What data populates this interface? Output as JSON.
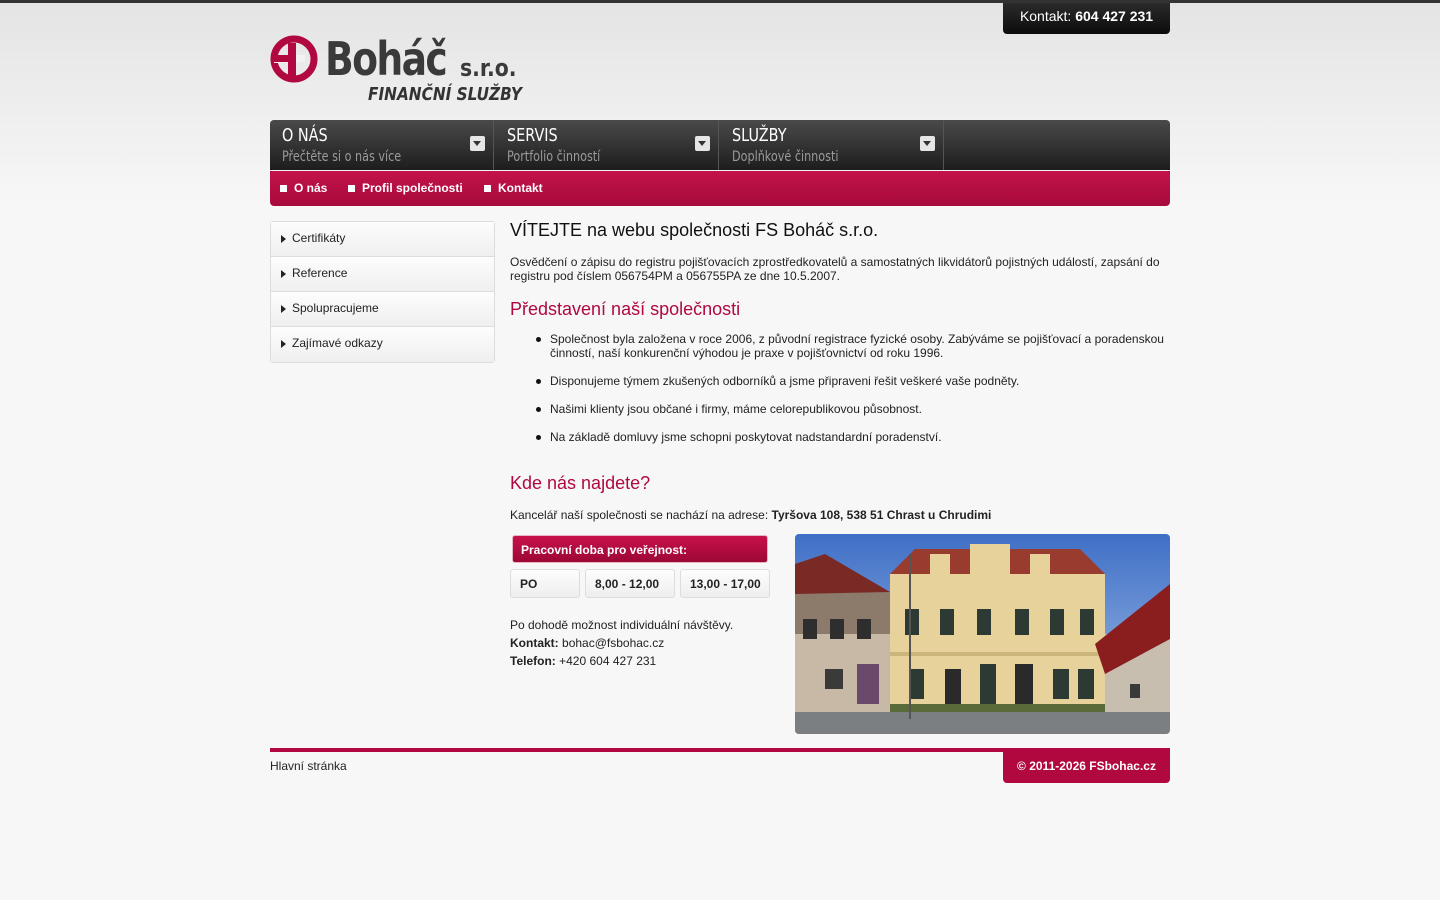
{
  "header": {
    "contact_label": "Kontakt:",
    "contact_phone": "604 427 231"
  },
  "logo": {
    "name": "Boháč",
    "suffix": "s.r.o.",
    "subtitle": "FINANČNÍ SLUŽBY",
    "icon": "fs-logo-mark-icon",
    "brand_color": "#b0083f"
  },
  "menu": {
    "items": [
      {
        "title": "O NÁS",
        "subtitle": "Přečtěte si o nás více"
      },
      {
        "title": "SERVIS",
        "subtitle": "Portfolio činností"
      },
      {
        "title": "SLUŽBY",
        "subtitle": "Doplňkové činnosti"
      }
    ],
    "arrow_icon": "chevron-down-icon"
  },
  "submenu": {
    "items": [
      "O nás",
      "Profil společnosti",
      "Kontakt"
    ]
  },
  "sidebar": {
    "items": [
      "Certifikáty",
      "Reference",
      "Spolupracujeme",
      "Zajímavé odkazy"
    ]
  },
  "main": {
    "title": "VÍTEJTE na webu společnosti FS Boháč s.r.o.",
    "intro": "Osvědčení o zápisu do registru pojišťovacích zprostředkovatelů a samostatných likvidátorů pojistných událostí, zapsání do registru pod číslem 056754PM a 056755PA ze dne 10.5.2007.",
    "section1_title": "Představení naší společnosti",
    "bullets": [
      "Společnost byla založena v roce 2006, z původní registrace fyzické osoby. Zabýváme se pojišťovací a poradenskou činností, naší konkurenční výhodou je praxe v pojišťovnictví od roku 1996.",
      "Disponujeme týmem zkušených odborníků a jsme připraveni řešit veškeré vaše podněty.",
      "Našimi klienty jsou občané i firmy, máme celorepublikovou působnost.",
      "Na základě domluvy jsme schopni poskytovat nadstandardní poradenství."
    ],
    "section2_title": "Kde nás najdete?",
    "address_prefix": "Kancelář naší společnosti se nachází na adrese:",
    "address": "Tyršova 108, 538 51 Chrast u Chrudimi",
    "hours_title": "Pracovní doba pro veřejnost:",
    "hours": {
      "day": "PO",
      "morning": "8,00 - 12,00",
      "afternoon": "13,00 - 17,00"
    },
    "note": "Po dohodě možnost individuální návštěvy.",
    "contact_label": "Kontakt:",
    "contact_email": "bohac@fsbohac.cz",
    "phone_label": "Telefon:",
    "phone": "+420 604 427 231"
  },
  "footer": {
    "home_link": "Hlavní stránka",
    "copyright": "© 2011-2026 FSbohac.cz"
  }
}
